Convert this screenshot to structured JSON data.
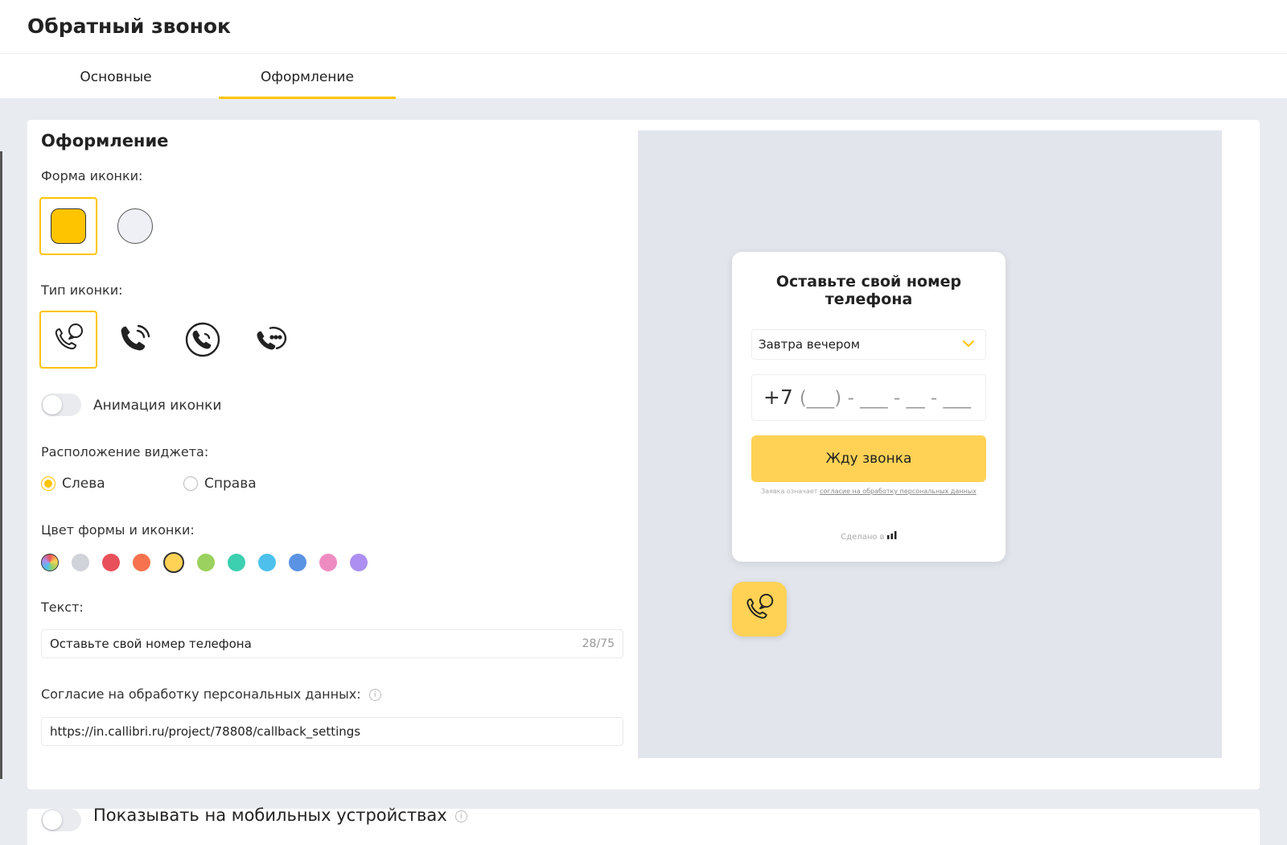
{
  "page": {
    "title": "Обратный звонок"
  },
  "tabs": [
    {
      "label": "Основные",
      "active": false
    },
    {
      "label": "Оформление",
      "active": true
    }
  ],
  "design": {
    "section_title": "Оформление",
    "icon_shape_label": "Форма иконки:",
    "icon_type_label": "Тип иконки:",
    "animation_label": "Анимация иконки",
    "position_label": "Расположение виджета:",
    "position_options": [
      {
        "label": "Слева",
        "selected": true
      },
      {
        "label": "Справа",
        "selected": false
      }
    ],
    "color_label": "Цвет формы и иконки:",
    "colors": [
      "gradient",
      "#d0d3d9",
      "#e8505b",
      "#f7724e",
      "#ffd256",
      "#9bd15e",
      "#3ccfb0",
      "#4dc1ec",
      "#5b93e4",
      "#ee8cc2",
      "#ac8ff0"
    ],
    "selected_color_index": 4,
    "text_label": "Текст:",
    "text_value": "Оставьте свой номер телефона",
    "text_counter": "28/75",
    "consent_label": "Согласие на обработку персональных данных:",
    "consent_url": "https://in.callibri.ru/project/78808/callback_settings"
  },
  "preview": {
    "title": "Оставьте свой номер телефона",
    "select_value": "Завтра вечером",
    "phone_prefix": "+7",
    "phone_mask": "(___) - ___ - __ - ___",
    "button_label": "Жду звонка",
    "consent_prefix": "Заявка означает",
    "consent_link": "согласие на обработку персональных данных",
    "made_in": "Сделано в"
  },
  "mobile": {
    "label": "Показывать на мобильных устройствах"
  },
  "theme": {
    "accent": "#ffc400",
    "button": "#ffd256"
  }
}
